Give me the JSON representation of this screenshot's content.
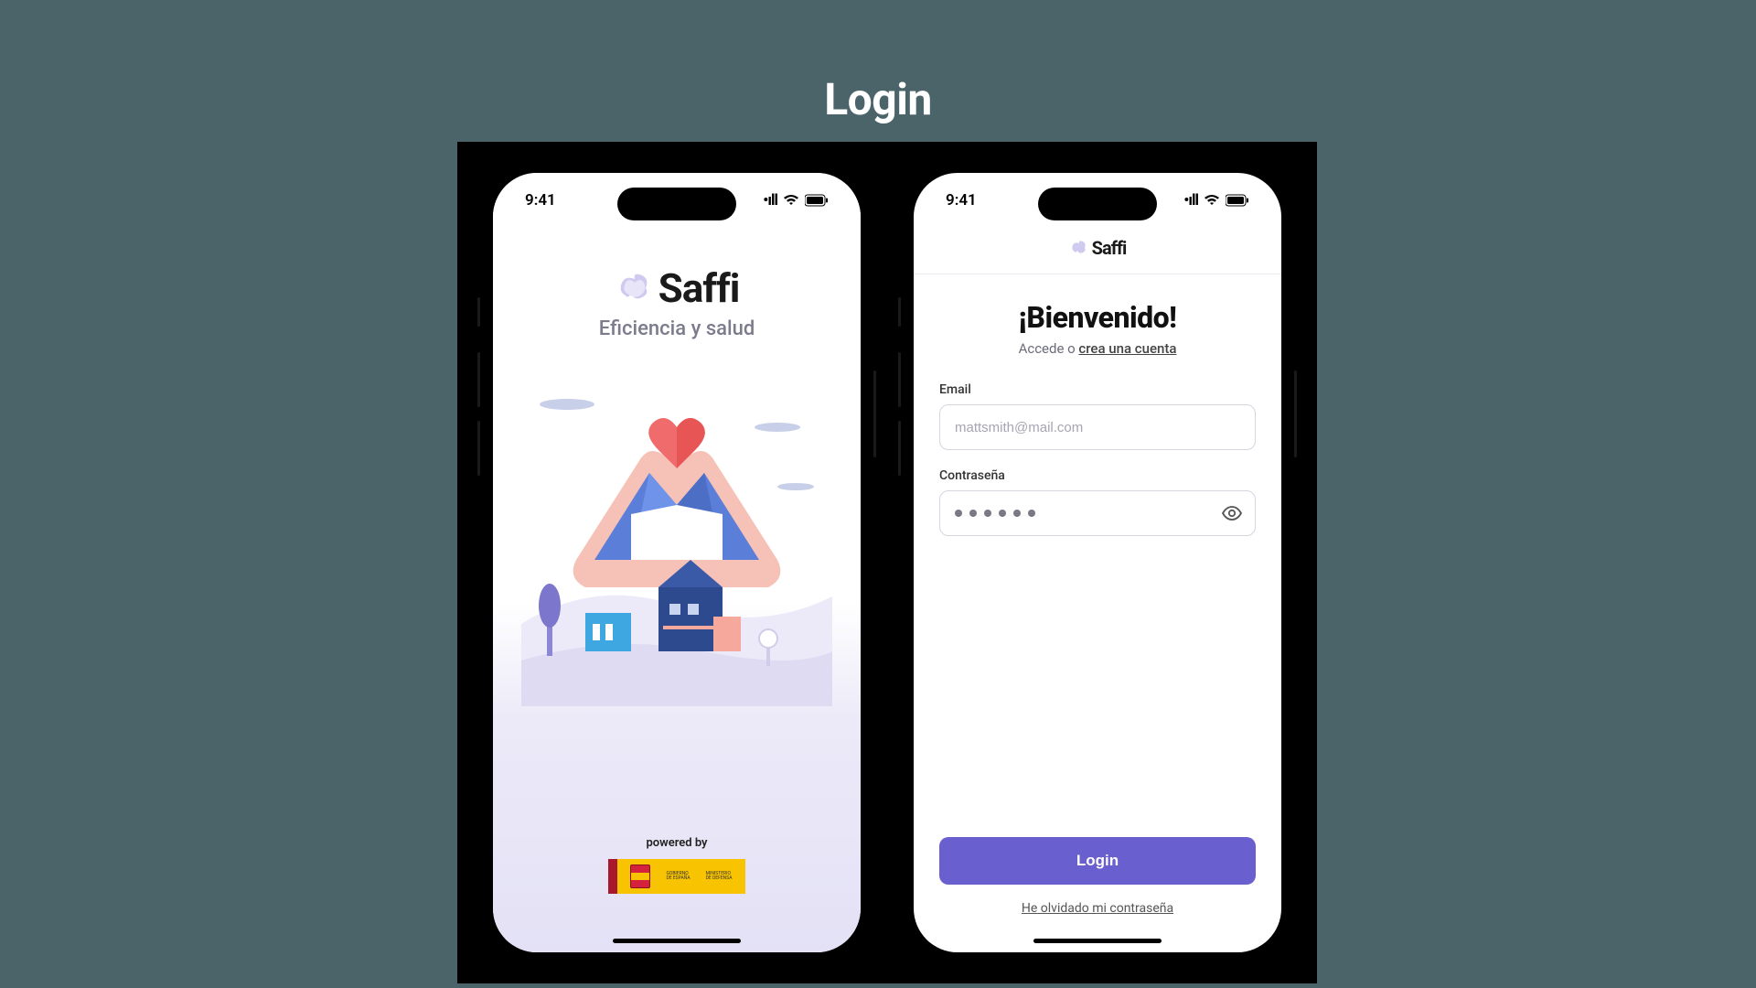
{
  "page_title": "Login",
  "status": {
    "time": "9:41"
  },
  "brand": {
    "name": "Saffi"
  },
  "splash": {
    "tagline": "Eficiencia y salud",
    "powered_by": "powered by",
    "gov_text1": "GOBIERNO\nDE ESPAÑA",
    "gov_text2": "MINISTERIO\nDE DEFENSA"
  },
  "login": {
    "welcome_title": "¡Bienvenido!",
    "welcome_prefix": "Accede o ",
    "welcome_link": "crea una cuenta",
    "email_label": "Email",
    "email_placeholder": "mattsmith@mail.com",
    "password_label": "Contraseña",
    "password_mask_count": 6,
    "login_button": "Login",
    "forgot_link": "He olvidado mi contraseña"
  }
}
